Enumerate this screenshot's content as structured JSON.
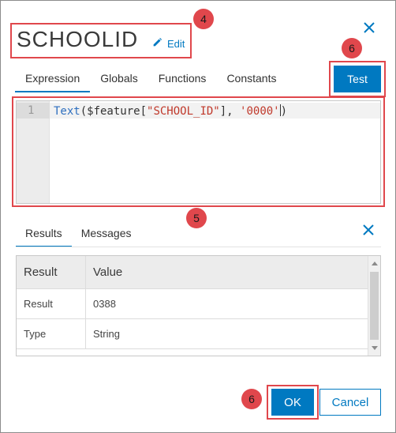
{
  "header": {
    "title": "SCHOOLID",
    "edit_label": "Edit"
  },
  "tabs": [
    {
      "label": "Expression",
      "active": true
    },
    {
      "label": "Globals"
    },
    {
      "label": "Functions"
    },
    {
      "label": "Constants"
    }
  ],
  "test_button_label": "Test",
  "editor": {
    "line_number": "1",
    "code": {
      "fn": "Text",
      "open": "($feature[",
      "field": "\"SCHOOL_ID\"",
      "mid": "], ",
      "format": "'0000'",
      "close": ")"
    }
  },
  "results": {
    "tabs": [
      {
        "label": "Results",
        "active": true
      },
      {
        "label": "Messages"
      }
    ],
    "columns": [
      "Result",
      "Value"
    ],
    "rows": [
      {
        "label": "Result",
        "value": "0388"
      },
      {
        "label": "Type",
        "value": "String"
      }
    ]
  },
  "buttons": {
    "ok_label": "OK",
    "cancel_label": "Cancel"
  },
  "callouts": {
    "title_badge": "4",
    "editor_badge": "5",
    "test_badge": "6",
    "ok_badge": "6"
  },
  "colors": {
    "accent": "#0079c1",
    "callout": "#e0474c"
  }
}
